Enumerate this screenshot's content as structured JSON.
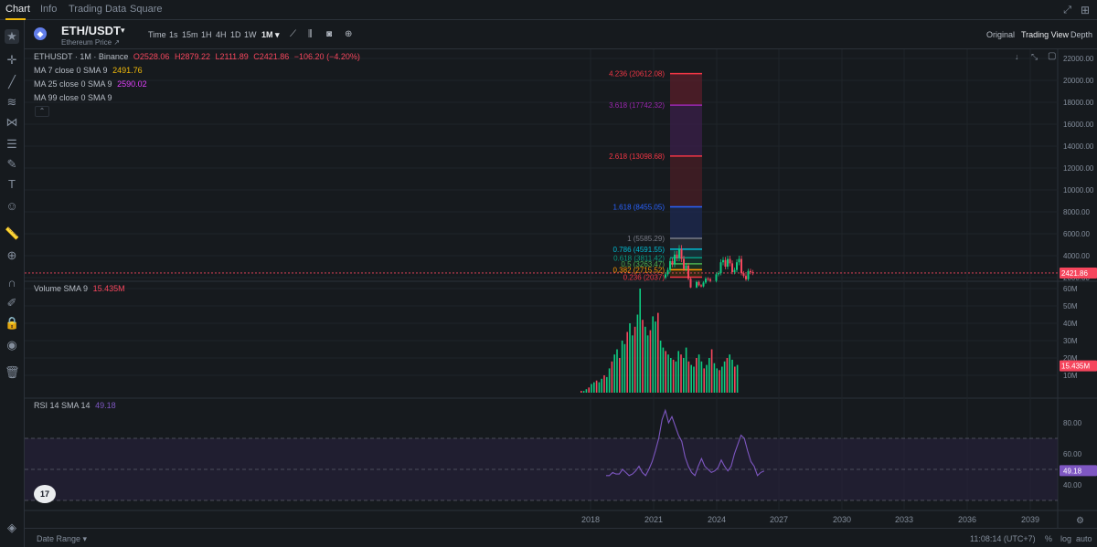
{
  "nav": {
    "tabs": [
      "Chart",
      "Info",
      "Trading Data",
      "Square"
    ]
  },
  "symbol": {
    "pair": "ETH/USDT",
    "subtitle": "Ethereum Price ↗",
    "intervals": [
      "Time",
      "1s",
      "15m",
      "1H",
      "4H",
      "1D",
      "1W",
      "1M ▾"
    ],
    "views": [
      "Original",
      "Trading View",
      "Depth"
    ]
  },
  "ohlc": {
    "prefix": "ETHUSDT · 1M · Binance",
    "open": "O2528.06",
    "high": "H2879.22",
    "low": "L2111.89",
    "close": "C2421.86",
    "change": "−106.20 (−4.20%)"
  },
  "indicators": {
    "ma7_label": "MA 7 close 0 SMA 9",
    "ma7_value": "2491.76",
    "ma25_label": "MA 25 close 0 SMA 9",
    "ma25_value": "2590.02",
    "ma99_label": "MA 99 close 0 SMA 9",
    "volume_label": "Volume SMA 9",
    "volume_value": "15.435M",
    "rsi_label": "RSI 14 SMA 14",
    "rsi_value": "49.18"
  },
  "fib": [
    {
      "label": "4.236 (20612.08)",
      "color": "#f23645"
    },
    {
      "label": "3.618 (17742.32)",
      "color": "#9c27b0"
    },
    {
      "label": "2.618 (13098.68)",
      "color": "#f23645"
    },
    {
      "label": "1.618 (8455.05)",
      "color": "#2962ff"
    },
    {
      "label": "1 (5585.29)",
      "color": "#787b86"
    },
    {
      "label": "0.786 (4591.55)",
      "color": "#00bcd4"
    },
    {
      "label": "0.618 (3811.42)",
      "color": "#089981"
    },
    {
      "label": "0.5 (3263.47)",
      "color": "#4caf50"
    },
    {
      "label": "0.382 (2715.52)",
      "color": "#ff9800"
    },
    {
      "label": "0.236 (2037)",
      "color": "#f23645"
    }
  ],
  "price_axis": [
    "22000.00",
    "20000.00",
    "18000.00",
    "16000.00",
    "14000.00",
    "12000.00",
    "10000.00",
    "8000.00",
    "6000.00",
    "4000.00",
    "2000.00"
  ],
  "price_current": "2421.86",
  "volume_axis": [
    "60M",
    "50M",
    "40M",
    "30M",
    "20M",
    "10M"
  ],
  "volume_current": "15.435M",
  "rsi_axis": [
    "80.00",
    "60.00",
    "40.00"
  ],
  "rsi_current": "49.18",
  "time_axis": [
    "2018",
    "2021",
    "2024",
    "2027",
    "2030",
    "2033",
    "2036",
    "2039"
  ],
  "bottom": {
    "date_range": "Date Range ▾",
    "clock": "11:08:14 (UTC+7)",
    "percent": "%",
    "log": "log",
    "auto": "auto"
  },
  "colors": {
    "up": "#0ecb81",
    "down": "#f6465d",
    "rsi": "#7e57c2",
    "accent": "#f0b90b"
  }
}
